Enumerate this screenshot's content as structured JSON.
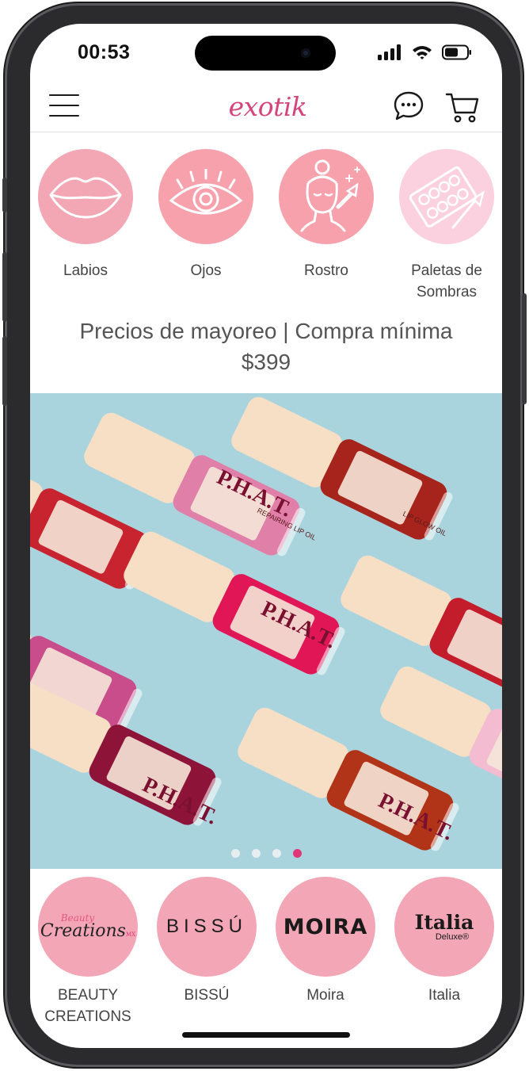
{
  "status_bar": {
    "time": "00:53"
  },
  "header": {
    "logo": "exotik"
  },
  "categories": [
    {
      "label": "Labios",
      "icon": "lips-icon",
      "color": "#f3a7b4"
    },
    {
      "label": "Ojos",
      "icon": "eye-icon",
      "color": "#f7a1ac"
    },
    {
      "label": "Rostro",
      "icon": "face-makeup-icon",
      "color": "#f7a1ac"
    },
    {
      "label": "Paletas de Sombras",
      "icon": "eyeshadow-palette-icon",
      "color": "#fbd1df"
    }
  ],
  "promo": {
    "line1": "Precios de mayoreo | Compra mínima",
    "line2": "$399"
  },
  "banner": {
    "product_text": "P.H.A.T.",
    "products": [
      "LIP GLOW OIL",
      "REPAIRING LIP OIL"
    ],
    "slides_total": 4,
    "active_slide": 4
  },
  "brands": [
    {
      "label": "BEAUTY CREATIONS",
      "logo_line1": "Beauty",
      "logo_line2": "Creations",
      "logo_suffix": "MX"
    },
    {
      "label": "BISSÚ",
      "logo": "BISSÚ"
    },
    {
      "label": "Moira",
      "logo": "MOIRA"
    },
    {
      "label": "Italia",
      "logo": "Italia",
      "logo_sub": "Deluxe®"
    }
  ],
  "colors": {
    "accent": "#e03677",
    "brand_circle": "#f2a6b6",
    "banner_bg": "#a9d4de"
  }
}
